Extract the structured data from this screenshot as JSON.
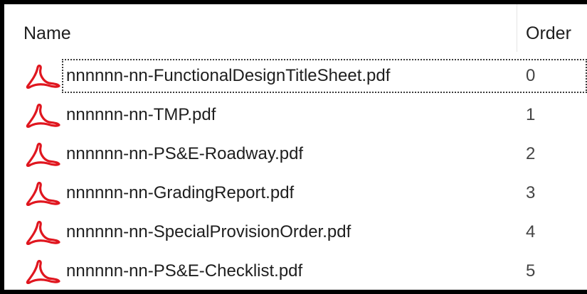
{
  "header": {
    "name_label": "Name",
    "order_label": "Order"
  },
  "files": [
    {
      "name": "nnnnnn-nn-FunctionalDesignTitleSheet.pdf",
      "order": "0",
      "icon": "pdf-icon",
      "selected": true
    },
    {
      "name": "nnnnnn-nn-TMP.pdf",
      "order": "1",
      "icon": "pdf-icon",
      "selected": false
    },
    {
      "name": "nnnnnn-nn-PS&E-Roadway.pdf",
      "order": "2",
      "icon": "pdf-icon",
      "selected": false
    },
    {
      "name": "nnnnnn-nn-GradingReport.pdf",
      "order": "3",
      "icon": "pdf-icon",
      "selected": false
    },
    {
      "name": "nnnnnn-nn-SpecialProvisionOrder.pdf",
      "order": "4",
      "icon": "pdf-icon",
      "selected": false
    },
    {
      "name": "nnnnnn-nn-PS&E-Checklist.pdf",
      "order": "5",
      "icon": "pdf-icon",
      "selected": false
    }
  ],
  "colors": {
    "pdf_icon": "#e0161f",
    "frame_border": "#000000",
    "text": "#1e1e1e"
  }
}
